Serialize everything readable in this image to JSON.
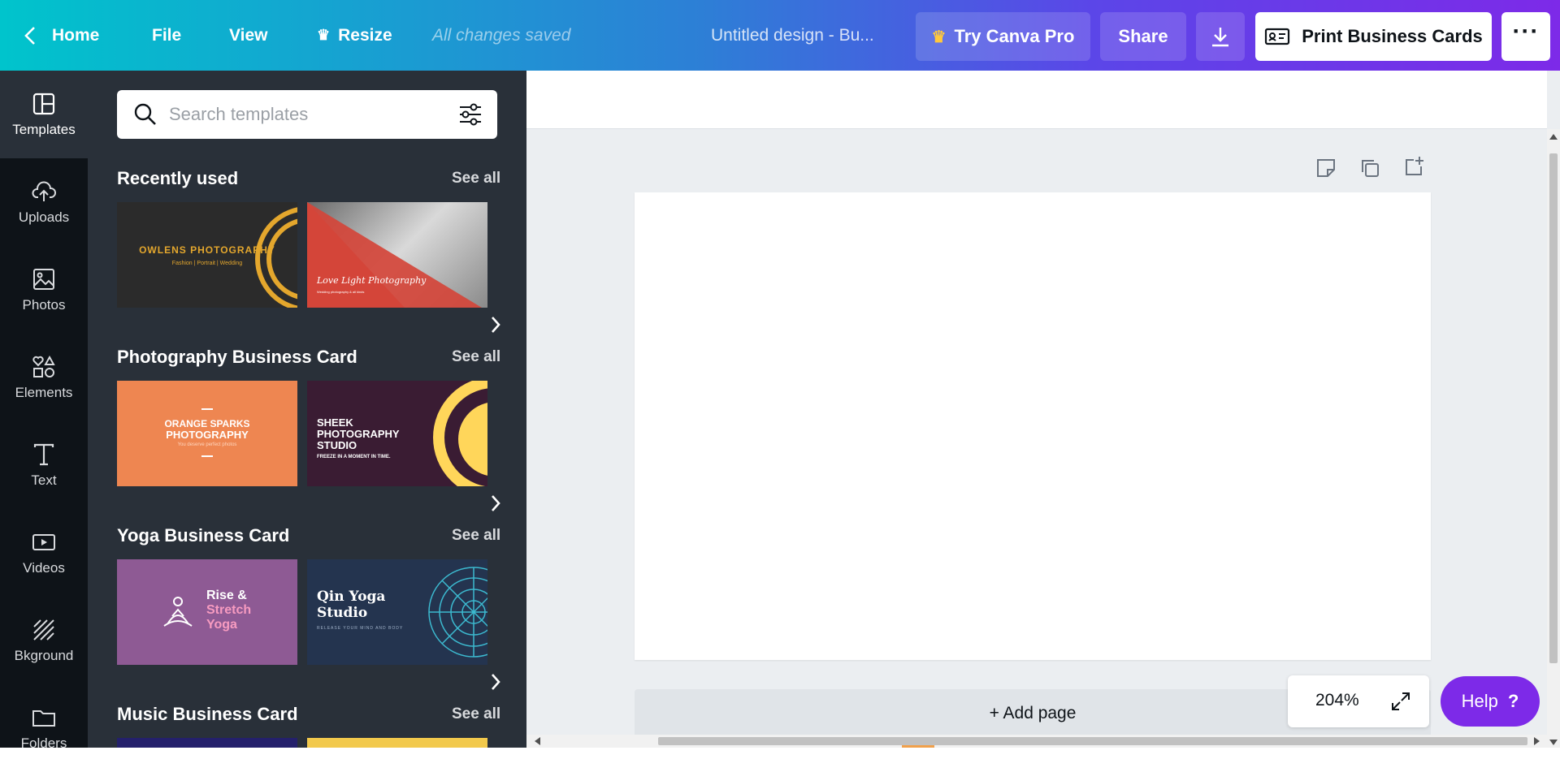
{
  "topbar": {
    "home": "Home",
    "file": "File",
    "view": "View",
    "resize": "Resize",
    "saved_status": "All changes saved",
    "doc_title": "Untitled design - Bu...",
    "try_pro": "Try Canva Pro",
    "share": "Share",
    "print": "Print Business Cards"
  },
  "rail": [
    {
      "label": "Templates",
      "icon": "templates-icon"
    },
    {
      "label": "Uploads",
      "icon": "upload-cloud-icon"
    },
    {
      "label": "Photos",
      "icon": "image-icon"
    },
    {
      "label": "Elements",
      "icon": "shapes-icon"
    },
    {
      "label": "Text",
      "icon": "text-icon"
    },
    {
      "label": "Videos",
      "icon": "video-icon"
    },
    {
      "label": "Bkground",
      "icon": "background-icon"
    },
    {
      "label": "Folders",
      "icon": "folder-icon"
    }
  ],
  "search": {
    "placeholder": "Search templates"
  },
  "sections": [
    {
      "title": "Recently used",
      "see_all": "See all"
    },
    {
      "title": "Photography Business Card",
      "see_all": "See all"
    },
    {
      "title": "Yoga Business Card",
      "see_all": "See all"
    },
    {
      "title": "Music Business Card",
      "see_all": "See all"
    }
  ],
  "templates": {
    "owlens_title": "OWLENS PHOTOGRAPHY",
    "owlens_sub": "Fashion | Portrait | Wedding",
    "lovelight_title": "Love Light Photography",
    "lovelight_sub": "Wedding photography & all kinds",
    "orange_title1": "ORANGE SPARKS",
    "orange_title2": "PHOTOGRAPHY",
    "orange_sub": "You deserve perfect photos",
    "sheek_title1": "SHEEK",
    "sheek_title2": "PHOTOGRAPHY",
    "sheek_title3": "STUDIO",
    "sheek_sub": "FREEZE IN A MOMENT IN TIME.",
    "rise1": "Rise &",
    "rise2": "Stretch",
    "rise3": "Yoga",
    "qin1": "Qin Yoga",
    "qin2": "Studio",
    "qin_sub": "RELEASE YOUR MIND AND BODY"
  },
  "canvas": {
    "add_page": "+ Add page",
    "zoom": "204%",
    "help": "Help",
    "help_icon": "?"
  },
  "colors": {
    "brand_purple": "#7d2ae8",
    "teal": "#00c4cc",
    "panel": "#293039",
    "rail": "#0e1318"
  }
}
